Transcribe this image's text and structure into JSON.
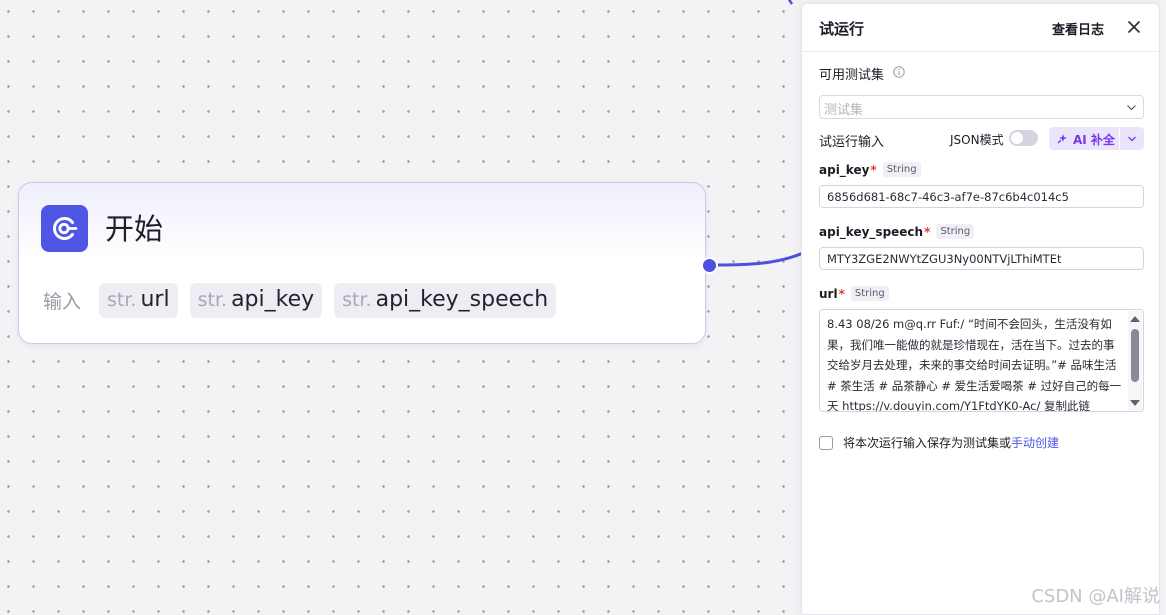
{
  "canvas": {
    "start_node": {
      "title": "开始",
      "input_label": "输入",
      "inputs": [
        {
          "type": "str.",
          "name": "url"
        },
        {
          "type": "str.",
          "name": "api_key"
        },
        {
          "type": "str.",
          "name": "api_key_speech"
        }
      ]
    }
  },
  "panel": {
    "title": "试运行",
    "view_log": "查看日志",
    "close_icon": "close-icon",
    "test_set_label": "可用测试集",
    "test_set_placeholder": "测试集",
    "run_input_label": "试运行输入",
    "json_mode_label": "JSON模式",
    "json_mode_on": false,
    "ai_complete_label": "AI 补全",
    "fields": [
      {
        "name": "api_key",
        "type": "String",
        "required": "*",
        "value": "6856d681-68c7-46c3-af7e-87c6b4c014c5"
      },
      {
        "name": "api_key_speech",
        "type": "String",
        "required": "*",
        "value": "MTY3ZGE2NWYtZGU3Ny00NTVjLThiMTEt"
      },
      {
        "name": "url",
        "type": "String",
        "required": "*",
        "value": "8.43 08/26 m@q.rr Fuf:/ “时间不会回头，生活没有如果，我们唯一能做的就是珍惜现在，活在当下。过去的事交给岁月去处理，未来的事交给时间去证明。”# 品味生活 # 茶生活 # 品茶静心 # 爱生活爱喝茶 # 过好自己的每一天  https://v.douyin.com/Y1FtdYK0-Ac/ 复制此链"
      }
    ],
    "save_text": "将本次运行输入保存为测试集或",
    "save_link": "手动创建"
  },
  "watermark": "CSDN @AI解说",
  "colors": {
    "accent": "#4f56e6",
    "ai_purple": "#7a36e8",
    "required_red": "#e2393c"
  }
}
